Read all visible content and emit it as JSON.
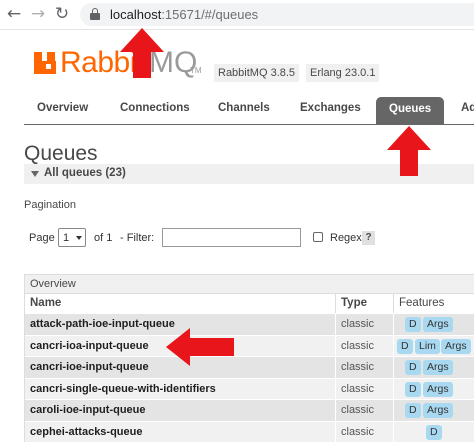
{
  "browser": {
    "url_host": "localhost",
    "url_rest": ":15671/#/queues",
    "back_icon": "back-arrow-icon",
    "forward_icon": "forward-arrow-icon",
    "reload_icon": "reload-icon"
  },
  "logo": {
    "rabbit": "Rabbit",
    "mq": "MQ",
    "tm": "TM"
  },
  "versions": {
    "rabbitmq": "RabbitMQ 3.8.5",
    "erlang": "Erlang 23.0.1"
  },
  "tabs": [
    {
      "label": "Overview"
    },
    {
      "label": "Connections"
    },
    {
      "label": "Channels"
    },
    {
      "label": "Exchanges"
    },
    {
      "label": "Queues",
      "active": true
    },
    {
      "label": "Ad"
    }
  ],
  "page": {
    "title": "Queues",
    "section_label": "All queues (23)",
    "pagination_label": "Pagination",
    "page_word": "Page",
    "page_value": "1",
    "of_pages": "of 1",
    "filter_label": "- Filter:",
    "filter_value": "",
    "regex_label": "Regex",
    "help": "?"
  },
  "table": {
    "caption": "Overview",
    "headers": {
      "name": "Name",
      "type": "Type",
      "features": "Features"
    },
    "rows": [
      {
        "name": "attack-path-ioe-input-queue",
        "type": "classic",
        "features": [
          "D",
          "Args"
        ]
      },
      {
        "name": "cancri-ioa-input-queue",
        "type": "classic",
        "features": [
          "D",
          "Lim",
          "Args"
        ]
      },
      {
        "name": "cancri-ioe-input-queue",
        "type": "classic",
        "features": [
          "D",
          "Args"
        ]
      },
      {
        "name": "cancri-single-queue-with-identifiers",
        "type": "classic",
        "features": [
          "D",
          "Args"
        ]
      },
      {
        "name": "caroli-ioe-input-queue",
        "type": "classic",
        "features": [
          "D",
          "Args"
        ]
      },
      {
        "name": "cephei-attacks-queue",
        "type": "classic",
        "features": [
          "D"
        ]
      }
    ]
  },
  "colors": {
    "annotation_arrow": "#e8151b",
    "brand": "#ff6600",
    "feature_badge": "#a8d9f0",
    "active_tab": "#666666"
  }
}
